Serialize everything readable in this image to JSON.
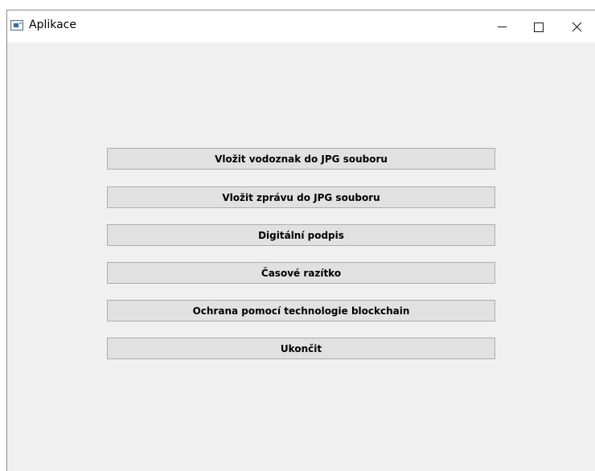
{
  "window": {
    "title": "Aplikace",
    "controls": {
      "minimize_icon": "minimize-icon",
      "maximize_icon": "maximize-icon",
      "close_icon": "close-icon"
    }
  },
  "menu": {
    "buttons": [
      {
        "label": "Vložit vodoznak do JPG souboru"
      },
      {
        "label": "Vložit zprávu do JPG souboru"
      },
      {
        "label": "Digitální podpis"
      },
      {
        "label": "Časové razítko"
      },
      {
        "label": "Ochrana pomocí technologie blockchain"
      },
      {
        "label": "Ukončit"
      }
    ]
  },
  "colors": {
    "window_background": "#f0f0f0",
    "titlebar_background": "#ffffff",
    "button_background": "#e1e1e1",
    "button_border": "#adadad"
  }
}
